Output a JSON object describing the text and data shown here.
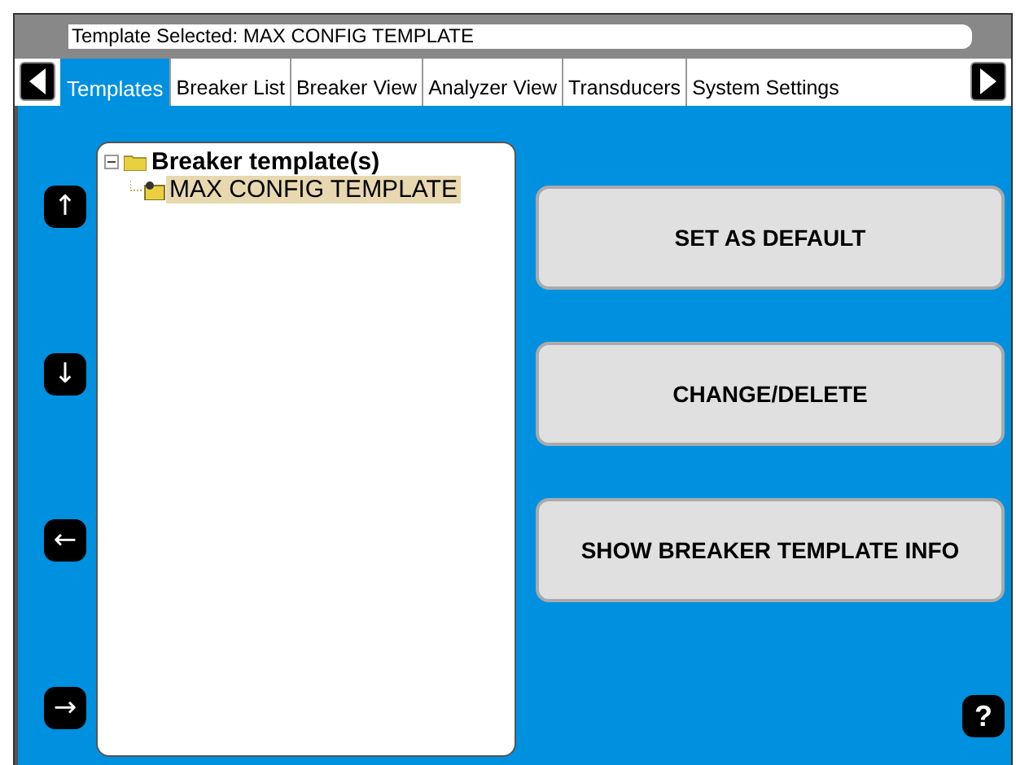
{
  "header": {
    "title": "Template Selected: MAX CONFIG TEMPLATE"
  },
  "tabs": [
    {
      "label": "Templates",
      "selected": true
    },
    {
      "label": "Breaker List",
      "selected": false
    },
    {
      "label": "Breaker View",
      "selected": false
    },
    {
      "label": "Analyzer View",
      "selected": false
    },
    {
      "label": "Transducers",
      "selected": false
    },
    {
      "label": "System Settings",
      "selected": false
    }
  ],
  "nav_keys": [
    "↑",
    "↓",
    "←",
    "→"
  ],
  "tree": {
    "label": "Breaker template(s)",
    "expanded": true,
    "children": [
      {
        "label": "MAX CONFIG TEMPLATE",
        "selected": true
      }
    ]
  },
  "actions": [
    "SET AS DEFAULT",
    "CHANGE/DELETE",
    "SHOW BREAKER TEMPLATE INFO"
  ],
  "help": "?"
}
